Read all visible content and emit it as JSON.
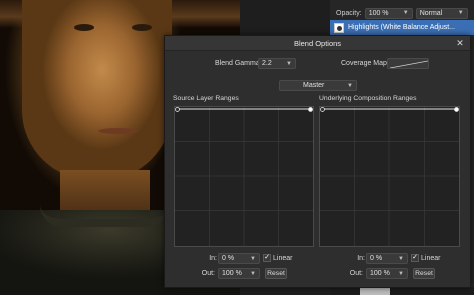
{
  "toolbar": {
    "opacity_label": "Opacity:",
    "opacity_value": "100 %",
    "blend_mode": "Normal"
  },
  "layer": {
    "name": "Highlights (White Balance Adjust..."
  },
  "dialog": {
    "title": "Blend Options",
    "close_icon": "close-icon",
    "blend_gamma_label": "Blend Gamma:",
    "blend_gamma_value": "2.2",
    "coverage_map_label": "Coverage Map:",
    "channel": "Master",
    "source": {
      "title": "Source Layer Ranges",
      "in_label": "In:",
      "in_value": "0 %",
      "out_label": "Out:",
      "out_value": "100 %",
      "linear_label": "Linear",
      "linear_checked": true,
      "reset_label": "Reset"
    },
    "underlying": {
      "title": "Underlying Composition Ranges",
      "in_label": "In:",
      "in_value": "0 %",
      "out_label": "Out:",
      "out_value": "100 %",
      "linear_label": "Linear",
      "linear_checked": true,
      "reset_label": "Reset"
    }
  },
  "colors": {
    "accent": "#3b6fb5",
    "dialog_bg": "#2e2e2e",
    "graph_bg": "#222222"
  }
}
